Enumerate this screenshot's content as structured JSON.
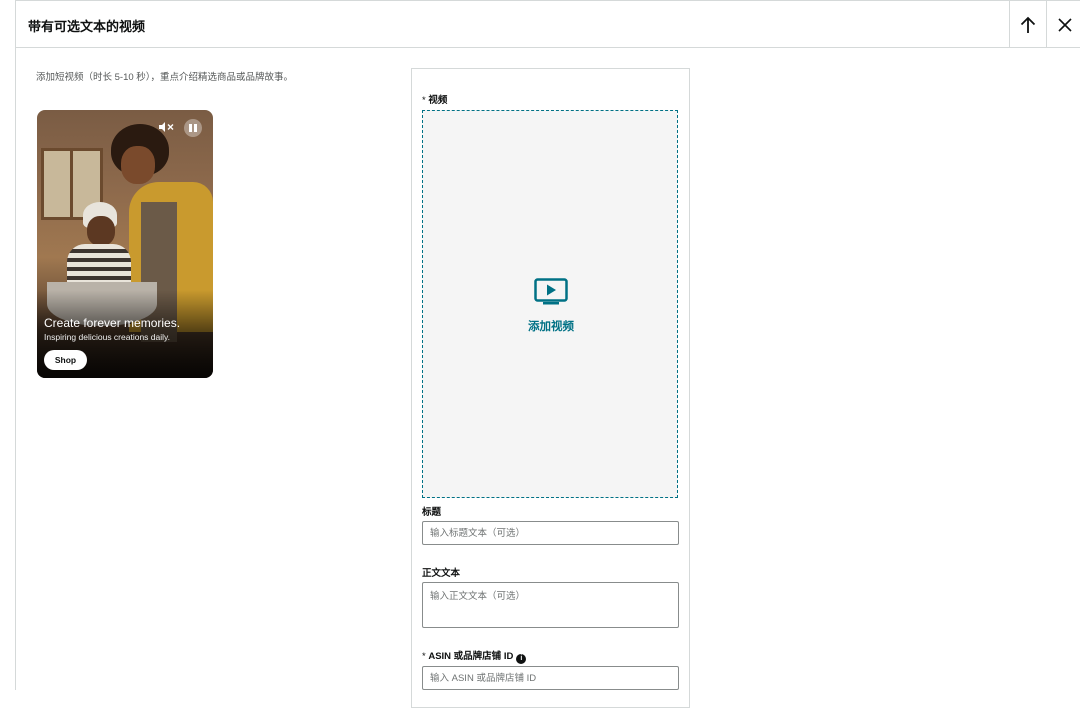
{
  "header": {
    "title": "带有可选文本的视频",
    "up_icon": "arrow-up-icon",
    "close_icon": "close-icon"
  },
  "description": "添加短视频（时长 5-10 秒），重点介绍精选商品或品牌故事。",
  "preview": {
    "headline": "Create forever memories.",
    "subtext": "Inspiring delicious creations daily.",
    "shop_label": "Shop",
    "mute_icon": "mute-icon",
    "pause_icon": "pause-icon"
  },
  "form": {
    "video": {
      "required_mark": "* ",
      "label": "视频",
      "drop_label": "添加视频",
      "icon": "video-play-icon"
    },
    "title": {
      "label": "标题",
      "placeholder": "输入标题文本（可选）",
      "value": ""
    },
    "body": {
      "label": "正文文本",
      "placeholder": "输入正文文本（可选）",
      "value": ""
    },
    "asin": {
      "required_mark": "* ",
      "label": "ASIN 或品牌店铺 ID",
      "info_icon": "info-icon",
      "placeholder": "输入 ASIN 或品牌店铺 ID",
      "value": ""
    }
  },
  "colors": {
    "accent": "#007185",
    "border": "#d5d9d9",
    "drop_bg": "#f5f5f5"
  }
}
